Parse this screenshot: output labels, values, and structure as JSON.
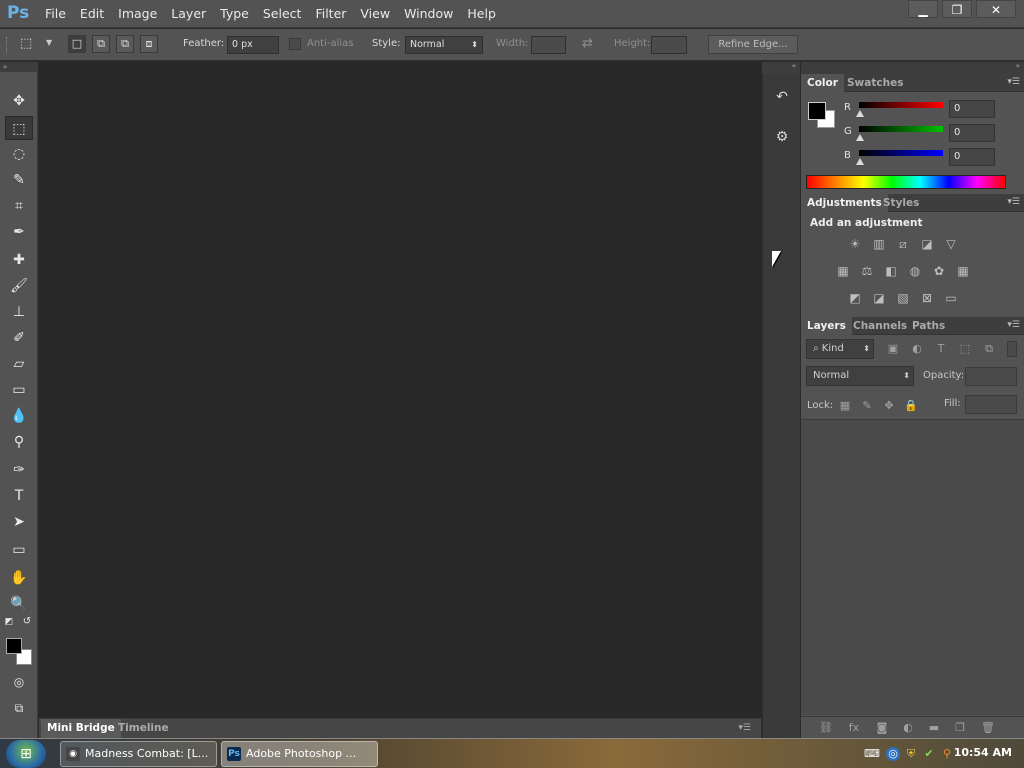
{
  "app": {
    "logo": "Ps"
  },
  "menu": [
    "File",
    "Edit",
    "Image",
    "Layer",
    "Type",
    "Select",
    "Filter",
    "View",
    "Window",
    "Help"
  ],
  "window_controls": {
    "minimize": "▁",
    "restore": "❐",
    "close": "✕"
  },
  "options": {
    "feather_label": "Feather:",
    "feather_value": "0 px",
    "antialias_label": "Anti-alias",
    "style_label": "Style:",
    "style_value": "Normal",
    "width_label": "Width:",
    "height_label": "Height:",
    "refine_edge": "Refine Edge..."
  },
  "tools": [
    {
      "name": "move-tool-icon",
      "glyph": "✥"
    },
    {
      "name": "rectangular-marquee-tool-icon",
      "glyph": "⬚",
      "active": true
    },
    {
      "name": "lasso-tool-icon",
      "glyph": "◌"
    },
    {
      "name": "quick-selection-tool-icon",
      "glyph": "✎"
    },
    {
      "name": "crop-tool-icon",
      "glyph": "⌗"
    },
    {
      "name": "eyedropper-tool-icon",
      "glyph": "✒"
    },
    {
      "name": "healing-brush-tool-icon",
      "glyph": "✚"
    },
    {
      "name": "brush-tool-icon",
      "glyph": "🖌"
    },
    {
      "name": "clone-stamp-tool-icon",
      "glyph": "⊥"
    },
    {
      "name": "history-brush-tool-icon",
      "glyph": "✐"
    },
    {
      "name": "eraser-tool-icon",
      "glyph": "▱"
    },
    {
      "name": "gradient-tool-icon",
      "glyph": "▭"
    },
    {
      "name": "blur-tool-icon",
      "glyph": "💧"
    },
    {
      "name": "dodge-tool-icon",
      "glyph": "⚲"
    },
    {
      "name": "pen-tool-icon",
      "glyph": "✑"
    },
    {
      "name": "type-tool-icon",
      "glyph": "T"
    },
    {
      "name": "path-selection-tool-icon",
      "glyph": "➤"
    },
    {
      "name": "rectangle-tool-icon",
      "glyph": "▭"
    },
    {
      "name": "hand-tool-icon",
      "glyph": "✋"
    },
    {
      "name": "zoom-tool-icon",
      "glyph": "🔍"
    }
  ],
  "bottom_tabs": {
    "mini_bridge": "Mini Bridge",
    "timeline": "Timeline"
  },
  "color_panel": {
    "tabs": [
      "Color",
      "Swatches"
    ],
    "r_label": "R",
    "g_label": "G",
    "b_label": "B",
    "r": "0",
    "g": "0",
    "b": "0",
    "colors": {
      "r": "#ff0000",
      "g": "#00c000",
      "b": "#0000ff"
    }
  },
  "adjustments_panel": {
    "tabs": [
      "Adjustments",
      "Styles"
    ],
    "heading": "Add an adjustment"
  },
  "layers_panel": {
    "tabs": [
      "Layers",
      "Channels",
      "Paths"
    ],
    "kind": "Kind",
    "blend_mode": "Normal",
    "opacity_label": "Opacity:",
    "lock_label": "Lock:",
    "fill_label": "Fill:"
  },
  "taskbar": {
    "tasks": [
      {
        "label": "Madness Combat: [L...",
        "icon": "madness-icon"
      },
      {
        "label": "Adobe Photoshop ...",
        "icon": "photoshop-icon"
      }
    ],
    "clock": "10:54 AM"
  }
}
